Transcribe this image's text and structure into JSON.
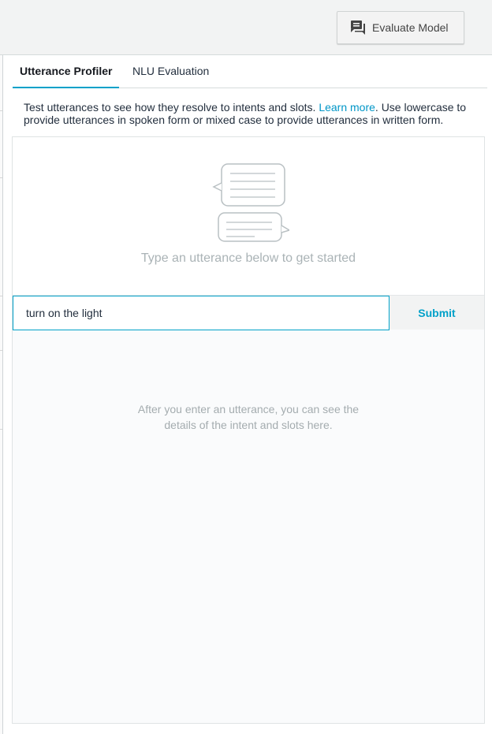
{
  "header": {
    "evaluate_button": "Evaluate Model",
    "evaluate_icon": "chat-bubbles-icon"
  },
  "tabs": [
    {
      "label": "Utterance Profiler",
      "active": true
    },
    {
      "label": "NLU Evaluation",
      "active": false
    }
  ],
  "description": {
    "before_link": "Test utterances to see how they resolve to intents and slots. ",
    "link": "Learn more",
    "after_link": ". Use lowercase to provide utterances in spoken form or mixed case to provide utterances in written form."
  },
  "hero": {
    "illustration": "conversation-bubbles-icon",
    "text": "Type an utterance below to get started"
  },
  "input": {
    "value": "turn on the light",
    "submit_label": "Submit"
  },
  "results": {
    "line1": "After you enter an utterance, you can see the",
    "line2": "details of the intent and slots here."
  },
  "colors": {
    "accent": "#00a1c9",
    "link": "#0096c7",
    "muted_text": "#a4acaf"
  }
}
